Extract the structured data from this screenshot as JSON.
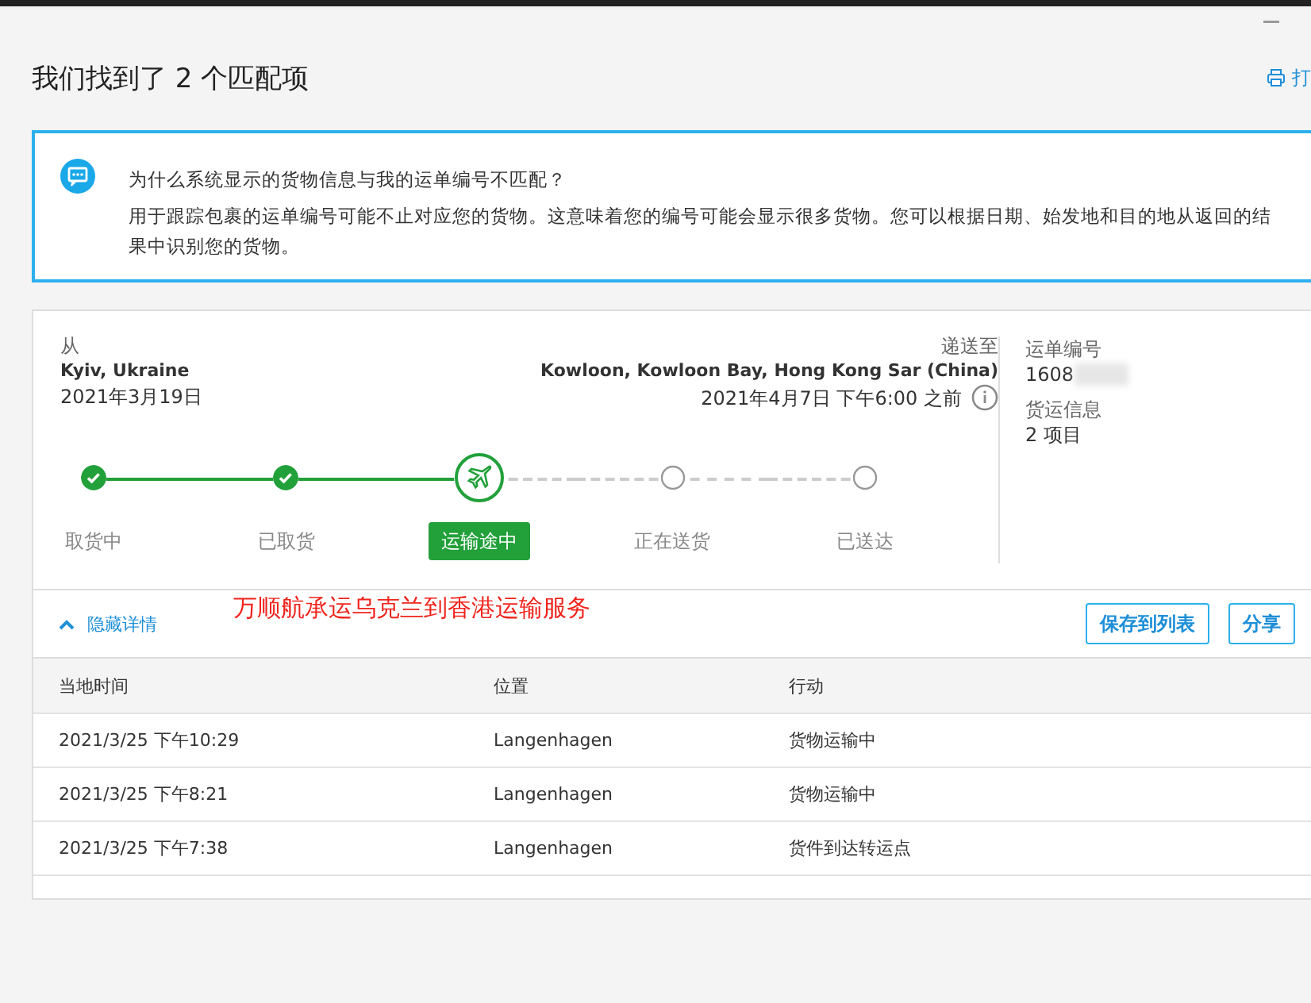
{
  "header": {
    "title": "我们找到了 2 个匹配项",
    "print_link": "打"
  },
  "notice": {
    "question": "为什么系统显示的货物信息与我的运单编号不匹配？",
    "body": "用于跟踪包裹的运单编号可能不止对应您的货物。这意味着您的编号可能会显示很多货物。您可以根据日期、始发地和目的地从返回的结果中识别您的货物。"
  },
  "shipment": {
    "from_label": "从",
    "from_place": "Kyiv, Ukraine",
    "from_date": "2021年3月19日",
    "to_label": "递送至",
    "to_place": "Kowloon, Kowloon Bay, Hong Kong Sar (China)",
    "to_date": "2021年4月7日 下午6:00 之前",
    "tracking_label": "运单编号",
    "tracking_number": "1608",
    "cargo_label": "货运信息",
    "cargo_value": "2 项目"
  },
  "steps": [
    {
      "label": "取货中",
      "kind": "done"
    },
    {
      "label": "已取货",
      "kind": "done"
    },
    {
      "label": "运输途中",
      "kind": "current"
    },
    {
      "label": "正在送货",
      "kind": "pending"
    },
    {
      "label": "已送达",
      "kind": "pending"
    }
  ],
  "details": {
    "toggle": "隐藏详情",
    "expanded": true,
    "caption": "万顺航承运乌克兰到香港运输服务",
    "buttons": [
      "保存到列表",
      "分享"
    ]
  },
  "table": {
    "columns": [
      "当地时间",
      "位置",
      "行动"
    ],
    "rows": [
      [
        "2021/3/25 下午10:29",
        "Langenhagen",
        "货物运输中"
      ],
      [
        "2021/3/25 下午8:21",
        "Langenhagen",
        "货物运输中"
      ],
      [
        "2021/3/25 下午7:38",
        "Langenhagen",
        "货件到达转运点"
      ]
    ]
  }
}
